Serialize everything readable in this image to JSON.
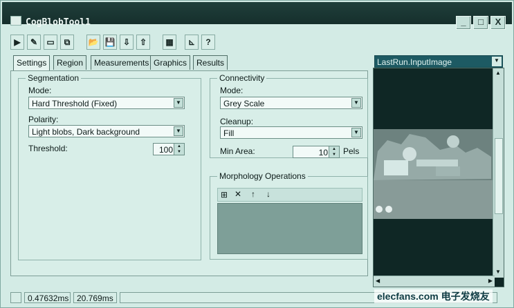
{
  "window": {
    "title": "CogBlobTool1",
    "controls": [
      "_",
      "□",
      "X"
    ]
  },
  "toolbar": {
    "icons": [
      "run-icon",
      "pen-icon",
      "display-icon",
      "copy-icon",
      "open-folder-icon",
      "save-icon",
      "import-icon",
      "export-icon",
      "calculator-icon",
      "chart-icon",
      "help-icon"
    ]
  },
  "tabs": [
    "Settings",
    "Region",
    "Measurements",
    "Graphics",
    "Results"
  ],
  "segmentation": {
    "group_label": "Segmentation",
    "mode_label": "Mode:",
    "mode_value": "Hard Threshold (Fixed)",
    "polarity_label": "Polarity:",
    "polarity_value": "Light blobs, Dark background",
    "threshold_label": "Threshold:",
    "threshold_value": "100"
  },
  "connectivity": {
    "group_label": "Connectivity",
    "mode_label": "Mode:",
    "mode_value": "Grey Scale",
    "cleanup_label": "Cleanup:",
    "cleanup_value": "Fill",
    "min_area_label": "Min Area:",
    "min_area_value": "10",
    "units_label": "Pels"
  },
  "morphology": {
    "group_label": "Morphology Operations"
  },
  "image_panel": {
    "selected_image": "LastRun.InputImage"
  },
  "status": {
    "time_1": "0.47632ms",
    "time_2": "20.769ms"
  },
  "watermark": {
    "text": "elecfans.com 电子发烧友"
  }
}
